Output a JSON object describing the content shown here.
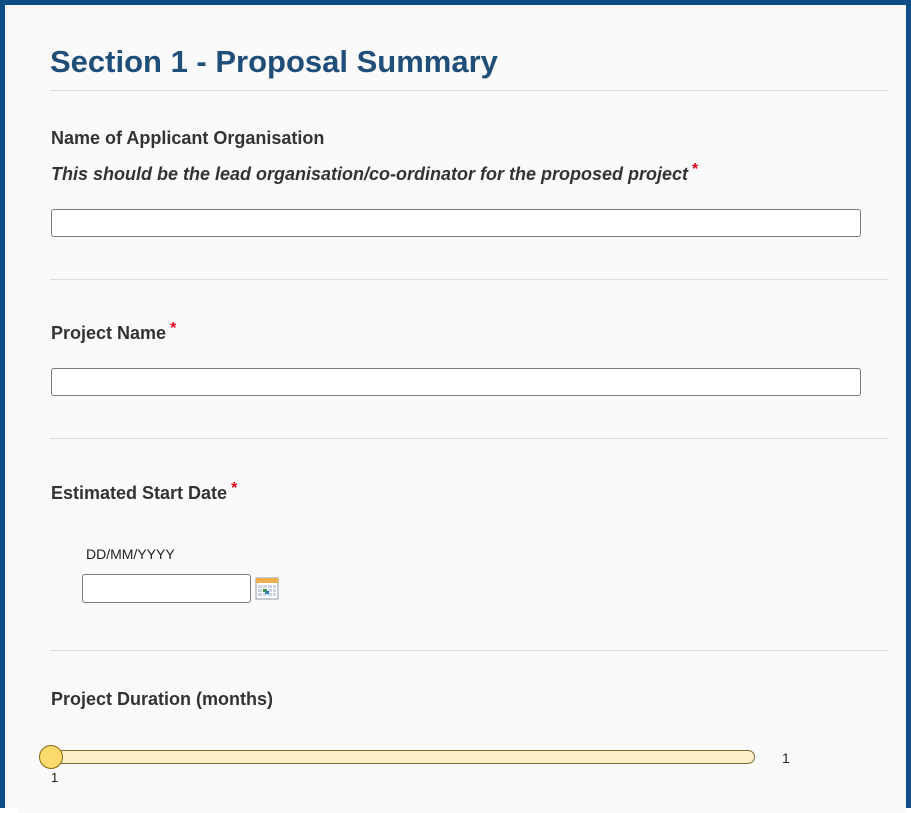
{
  "section": {
    "title": "Section 1 - Proposal Summary"
  },
  "applicant_org": {
    "label": "Name of Applicant Organisation",
    "hint": "This should be the lead organisation/co-ordinator for the proposed project",
    "required_mark": "*",
    "value": ""
  },
  "project_name": {
    "label": "Project Name",
    "required_mark": "*",
    "value": ""
  },
  "start_date": {
    "label": "Estimated Start Date",
    "required_mark": "*",
    "format": "DD/MM/YYYY",
    "value": "",
    "icon": "calendar-icon"
  },
  "duration": {
    "label": "Project Duration (months)",
    "value": "1",
    "min_label": "1",
    "current": 1,
    "min": 1
  },
  "colors": {
    "frame_border": "#0e4e87",
    "title": "#1f4e79",
    "required": "#e0001b",
    "slider_track": "#fdf1c8",
    "slider_handle": "#fbd96a"
  }
}
